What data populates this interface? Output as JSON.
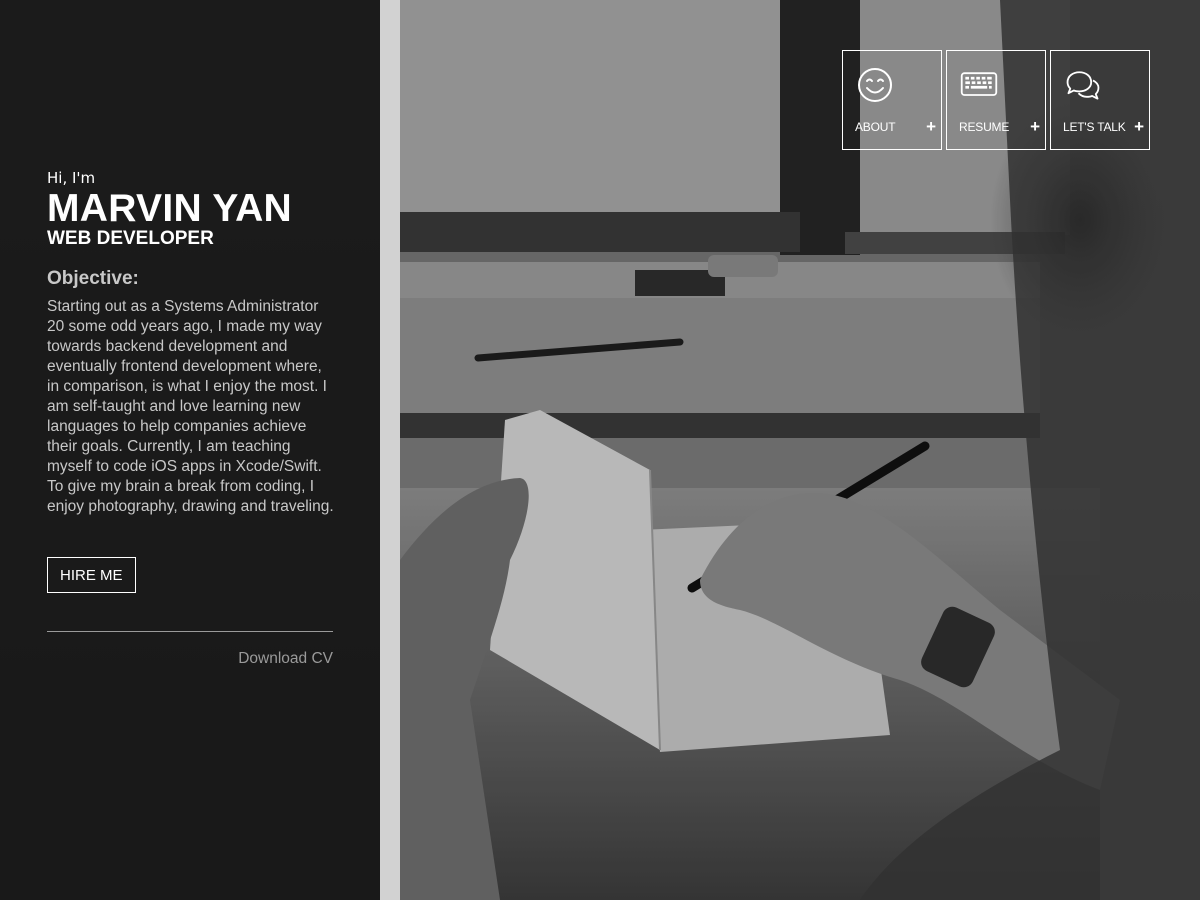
{
  "intro": {
    "greeting": "Hi, I'm",
    "name": "MARVIN YAN",
    "role": "WEB DEVELOPER"
  },
  "objective": {
    "heading": "Objective:",
    "text": "Starting out as a Systems Administrator 20 some odd years ago, I made my way towards backend development and eventually frontend development where, in comparison, is what I enjoy the most. I am self-taught and love learning new languages to help companies achieve their goals. Currently, I am teaching myself to code iOS apps in Xcode/Swift. To give my brain a break from coding, I enjoy photography, drawing and traveling."
  },
  "actions": {
    "hire_label": "HIRE ME",
    "download_label": "Download CV"
  },
  "nav": [
    {
      "label": "ABOUT",
      "icon": "smiley-icon",
      "expand": "+"
    },
    {
      "label": "RESUME",
      "icon": "keyboard-icon",
      "expand": "+"
    },
    {
      "label": "LET'S TALK",
      "icon": "chat-bubbles-icon",
      "expand": "+"
    }
  ],
  "colors": {
    "panel": "#0c0c0c",
    "divider": "#d2d2d2",
    "text_primary": "#ffffff",
    "text_muted": "#c8c8c8",
    "link_muted": "#9a9a9a"
  }
}
